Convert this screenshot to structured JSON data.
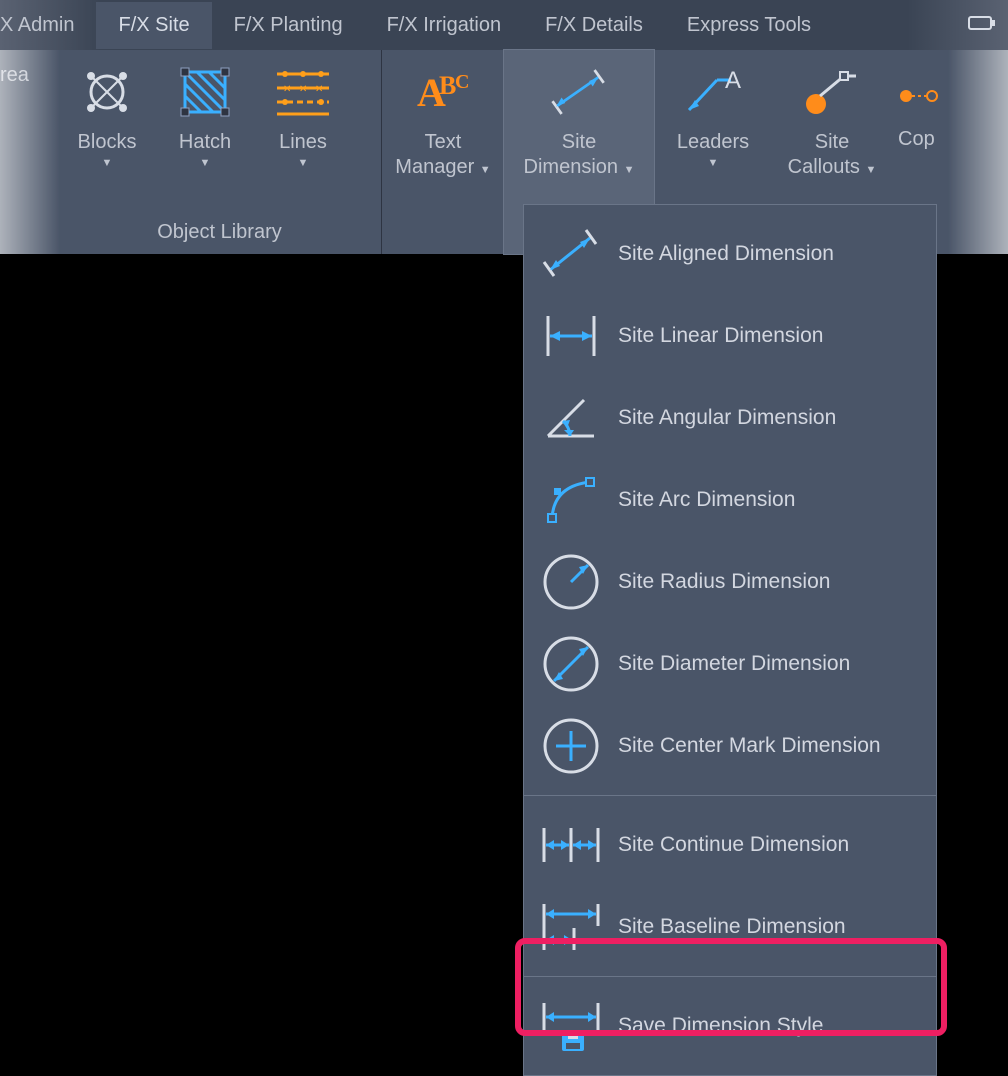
{
  "tabs": {
    "admin": "X Admin",
    "site": "F/X Site",
    "planting": "F/X Planting",
    "irrigation": "F/X Irrigation",
    "details": "F/X Details",
    "express": "Express Tools"
  },
  "left_cut": "rea",
  "right_cut": "Cop",
  "obj_lib_title": "Object Library",
  "buttons": {
    "blocks": "Blocks",
    "hatch": "Hatch",
    "lines": "Lines",
    "text_mgr_l1": "Text",
    "text_mgr_l2": "Manager",
    "site_dim_l1": "Site",
    "site_dim_l2": "Dimension",
    "leaders": "Leaders",
    "callouts_l1": "Site",
    "callouts_l2": "Callouts"
  },
  "dropdown": {
    "aligned": "Site Aligned Dimension",
    "linear": "Site Linear Dimension",
    "angular": "Site Angular Dimension",
    "arc": "Site Arc Dimension",
    "radius": "Site Radius Dimension",
    "diameter": "Site Diameter Dimension",
    "center": "Site Center Mark Dimension",
    "continue": "Site Continue Dimension",
    "baseline": "Site Baseline Dimension",
    "save": "Save Dimension Style"
  }
}
